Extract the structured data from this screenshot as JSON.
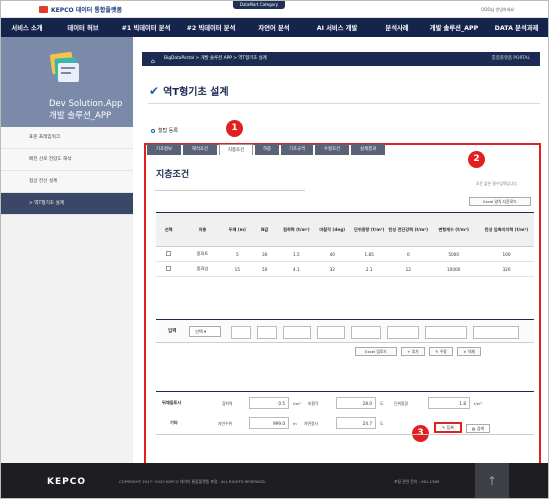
{
  "header": {
    "logo_text": "KEPCO 데이터 통합플랫폼",
    "datamart_tab": "DataMart Category",
    "user_text": "OOO님 안녕하세요"
  },
  "nav": {
    "items": [
      "서비스 소개",
      "데이터 허브",
      "#1 빅데이터 분석",
      "#2 빅데이터 분석",
      "자연어 분석",
      "AI 서비스 개발",
      "분석사례",
      "개발 솔루션_APP",
      "DATA 분석과제"
    ]
  },
  "sidebar": {
    "title_line1": "Dev Solution.App",
    "title_line2": "개발 솔루션_APP",
    "items": [
      {
        "label": "표준 프레임워크"
      },
      {
        "label": "배전 선로 전압도 해석"
      },
      {
        "label": "접상 전선 설계"
      },
      {
        "label": "> 역T형기초 설계"
      }
    ]
  },
  "breadcrumb": {
    "home": "⌂",
    "text": "BigDataPortal > 개발 솔루션 APP > 역T형기초 설계",
    "portal": "통합플랫폼 PORTAL"
  },
  "page": {
    "title": "역T형기초 설계",
    "section": "철탑 등록"
  },
  "tabs": [
    "기초정보",
    "해석조건",
    "지층조건",
    "하중",
    "기초규격",
    "수평조건",
    "설계결과"
  ],
  "sub": {
    "title": "지층조건",
    "note": "모든 값은 필수입력입니다.",
    "excel_download": "Excel 양식 다운로드"
  },
  "table": {
    "headers": [
      "선택",
      "지층",
      "두께 (m)",
      "N값",
      "점착력 (t/m²)",
      "마찰각 (deg)",
      "단위중량 (t/m³)",
      "탄성 전단강력 (t/m²)",
      "변형계수 (t/m²)",
      "탄성 압축지지력 (t/m²)"
    ],
    "rows": [
      [
        "",
        "풍화토",
        "5",
        "30",
        "1.5",
        "40",
        "1.85",
        "0",
        "5000",
        "100"
      ],
      [
        "",
        "풍화암",
        "15",
        "50",
        "4.1",
        "32",
        "2.1",
        "12",
        "10000",
        "320"
      ]
    ]
  },
  "input_row": {
    "label": "입력",
    "select_label": "선택",
    "buttons": [
      "Excel 업로드",
      "추가",
      "수정",
      "삭제"
    ]
  },
  "section2": {
    "row1_label": "뒤채움토사",
    "row1": [
      {
        "text": "점착력",
        "value": "0.5",
        "unit": "t/m²"
      },
      {
        "text": "마찰각",
        "value": "28.0",
        "unit": "도"
      },
      {
        "text": "단위중량",
        "value": "1.8",
        "unit": "t/m³"
      }
    ],
    "row2_label": "기타",
    "row2": [
      {
        "text": "지반수위",
        "value": "999.0",
        "unit": "m"
      },
      {
        "text": "저면경사",
        "value": "24.7",
        "unit": "도"
      }
    ]
  },
  "buttons": {
    "register": "✎ 등록",
    "search": "▤ 검색"
  },
  "badges": [
    "1",
    "2",
    "3"
  ],
  "footer": {
    "logo": "KEPCO",
    "copyright": "COPYRIGHT 2017~2020 KEPCO 데이터 통합플랫폼 포털 . ALL RIGHTS RESERVED.",
    "contact": "포털 관련 문의 : 061-1585",
    "up_icon": "↑"
  }
}
